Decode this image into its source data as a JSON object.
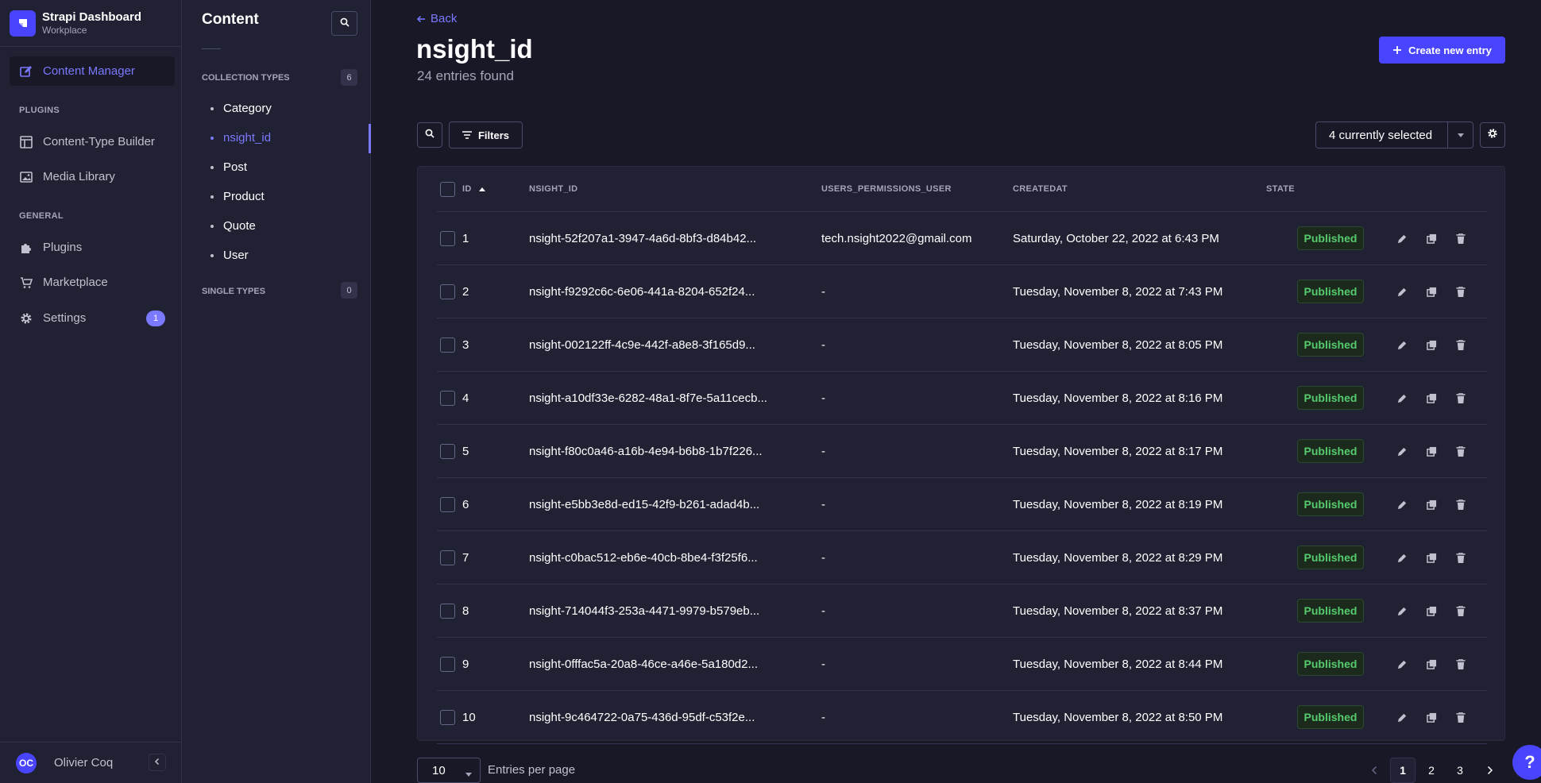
{
  "brand": {
    "title": "Strapi Dashboard",
    "subtitle": "Workplace"
  },
  "main_nav": {
    "content_manager": "Content Manager",
    "plugins_section": "PLUGINS",
    "content_type_builder": "Content-Type Builder",
    "media_library": "Media Library",
    "general_section": "GENERAL",
    "plugins": "Plugins",
    "marketplace": "Marketplace",
    "settings": "Settings",
    "settings_badge": "1"
  },
  "user": {
    "initials": "OC",
    "name": "Olivier Coq"
  },
  "sub_nav": {
    "title": "Content",
    "collection_types_label": "COLLECTION TYPES",
    "collection_types_count": "6",
    "collection_types": [
      "Category",
      "nsight_id",
      "Post",
      "Product",
      "Quote",
      "User"
    ],
    "active_index": 1,
    "single_types_label": "SINGLE TYPES",
    "single_types_count": "0"
  },
  "header": {
    "back": "Back",
    "title": "nsight_id",
    "subtitle": "24 entries found",
    "create_button": "Create new entry"
  },
  "toolbar": {
    "filters": "Filters",
    "columns_select": "4 currently selected"
  },
  "table": {
    "columns": [
      "ID",
      "NSIGHT_ID",
      "USERS_PERMISSIONS_USER",
      "CREATEDAT",
      "STATE"
    ],
    "rows": [
      {
        "id": "1",
        "nsight_id": "nsight-52f207a1-3947-4a6d-8bf3-d84b42...",
        "user": "tech.nsight2022@gmail.com",
        "created": "Saturday, October 22, 2022 at 6:43 PM",
        "state": "Published"
      },
      {
        "id": "2",
        "nsight_id": "nsight-f9292c6c-6e06-441a-8204-652f24...",
        "user": "-",
        "created": "Tuesday, November 8, 2022 at 7:43 PM",
        "state": "Published"
      },
      {
        "id": "3",
        "nsight_id": "nsight-002122ff-4c9e-442f-a8e8-3f165d9...",
        "user": "-",
        "created": "Tuesday, November 8, 2022 at 8:05 PM",
        "state": "Published"
      },
      {
        "id": "4",
        "nsight_id": "nsight-a10df33e-6282-48a1-8f7e-5a11cecb...",
        "user": "-",
        "created": "Tuesday, November 8, 2022 at 8:16 PM",
        "state": "Published"
      },
      {
        "id": "5",
        "nsight_id": "nsight-f80c0a46-a16b-4e94-b6b8-1b7f226...",
        "user": "-",
        "created": "Tuesday, November 8, 2022 at 8:17 PM",
        "state": "Published"
      },
      {
        "id": "6",
        "nsight_id": "nsight-e5bb3e8d-ed15-42f9-b261-adad4b...",
        "user": "-",
        "created": "Tuesday, November 8, 2022 at 8:19 PM",
        "state": "Published"
      },
      {
        "id": "7",
        "nsight_id": "nsight-c0bac512-eb6e-40cb-8be4-f3f25f6...",
        "user": "-",
        "created": "Tuesday, November 8, 2022 at 8:29 PM",
        "state": "Published"
      },
      {
        "id": "8",
        "nsight_id": "nsight-714044f3-253a-4471-9979-b579eb...",
        "user": "-",
        "created": "Tuesday, November 8, 2022 at 8:37 PM",
        "state": "Published"
      },
      {
        "id": "9",
        "nsight_id": "nsight-0fffac5a-20a8-46ce-a46e-5a180d2...",
        "user": "-",
        "created": "Tuesday, November 8, 2022 at 8:44 PM",
        "state": "Published"
      },
      {
        "id": "10",
        "nsight_id": "nsight-9c464722-0a75-436d-95df-c53f2e...",
        "user": "-",
        "created": "Tuesday, November 8, 2022 at 8:50 PM",
        "state": "Published"
      }
    ]
  },
  "pagination": {
    "per_page": "10",
    "per_page_label": "Entries per page",
    "pages": [
      "1",
      "2",
      "3"
    ],
    "current_page": "1"
  },
  "help": {
    "label": "?"
  },
  "colors": {
    "background": "#181826",
    "panel": "#212134",
    "accent": "#4945ff",
    "accent_light": "#7b79ff",
    "published": "#55cb6d"
  }
}
